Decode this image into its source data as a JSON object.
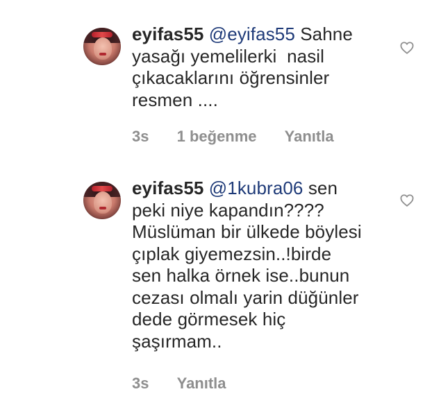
{
  "comments": [
    {
      "username": "eyifas55",
      "mention": "@eyifas55",
      "lines": [
        " Sahne",
        "yasağı yemelilerki  nasil",
        "çıkacaklarını öğrensinler",
        "resmen ...."
      ],
      "time": "3s",
      "likes": "1 beğenme",
      "reply": "Yanıtla",
      "like_icon": "heart-outline-icon"
    },
    {
      "username": "eyifas55",
      "mention": "@1kubra06",
      "lines": [
        " sen",
        "peki niye kapandın????",
        "Müslüman bir ülkede böylesi",
        "çıplak giyemezsin..!birde",
        "sen halka örnek ise..bunun",
        "cezası olmalı yarin düğünler",
        "dede görmesek hiç",
        "şaşırmam.."
      ],
      "time": "3s",
      "reply": "Yanıtla",
      "like_icon": "heart-outline-icon"
    }
  ]
}
